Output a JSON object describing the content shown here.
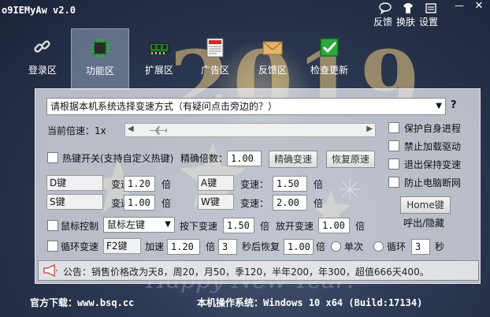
{
  "window": {
    "title": "o9IEMyAw v2.0",
    "actions": [
      {
        "label": "反馈",
        "icon": "feedback-icon"
      },
      {
        "label": "换肤",
        "icon": "skin-icon"
      },
      {
        "label": "设置",
        "icon": "settings-icon"
      }
    ],
    "minimize_label": "—",
    "close_label": "✕"
  },
  "background": {
    "year_text": "2019",
    "greeting": "Happy New Year!"
  },
  "tabs": [
    {
      "label": "登录区",
      "icon": "link-icon",
      "active": false
    },
    {
      "label": "功能区",
      "icon": "chip-icon",
      "active": true
    },
    {
      "label": "扩展区",
      "icon": "memory-icon",
      "active": false
    },
    {
      "label": "广告区",
      "icon": "newspaper-icon",
      "active": false
    },
    {
      "label": "反馈区",
      "icon": "envelope-icon",
      "active": false
    },
    {
      "label": "检查更新",
      "icon": "checkmark-icon",
      "active": false
    }
  ],
  "mode_select": {
    "value": "请根据本机系统选择变速方式（有疑问点击旁边的？）",
    "help": "?"
  },
  "speed": {
    "label": "当前倍速：1x"
  },
  "options": {
    "protect_process": "保护自身进程",
    "block_driver": "禁止加载驱动",
    "keep_speed_on_exit": "退出保持变速",
    "prevent_disconnect": "防止电脑断网"
  },
  "hotkey": {
    "toggle_label": "热键开关(支持自定义热键)",
    "precise_label": "精确倍数：",
    "precise_value": "1.00",
    "precise_button": "精确变速",
    "restore_button": "恢复原速"
  },
  "keys": {
    "d": {
      "key": "D键",
      "label": "变速：",
      "value": "1.20",
      "unit": "倍"
    },
    "a": {
      "key": "A键",
      "label": "变速：",
      "value": "1.50",
      "unit": "倍"
    },
    "s": {
      "key": "S键",
      "label": "变速：",
      "value": "1.00",
      "unit": "倍"
    },
    "w": {
      "key": "W键",
      "label": "变速：",
      "value": "2.00",
      "unit": "倍"
    }
  },
  "home": {
    "button": "Home键",
    "caption": "呼出/隐藏"
  },
  "mouse": {
    "label": "鼠标控制",
    "select_value": "鼠标左键",
    "press_label": "按下变速",
    "press_value": "1.50",
    "press_unit": "倍",
    "release_label": "放开变速",
    "release_value": "1.00",
    "release_unit": "倍"
  },
  "loop": {
    "label": "循环变速",
    "key": "F2键",
    "accel_label": "加速",
    "accel_value": "1.20",
    "accel_unit": "倍",
    "seconds_value": "3",
    "restore_label": "秒后恢复",
    "restore_value": "1.00",
    "restore_unit": "倍",
    "once_label": "单次",
    "loop_label": "循环",
    "loop_value": "3",
    "loop_unit": "秒"
  },
  "notice": {
    "text": "公告：销售价格改为天8，周20，月50，季120，半年200，年300，超值666天400。"
  },
  "footer": {
    "download_label": "官方下载：",
    "download_url": "www.bsq.cc",
    "os_label": "本机操作系统：",
    "os_value": "Windows 10 x64 (Build:17134)"
  },
  "colors": {
    "panel": "#e1e4ea",
    "background": "#2e3a55",
    "accent": "#1c7d2c"
  }
}
